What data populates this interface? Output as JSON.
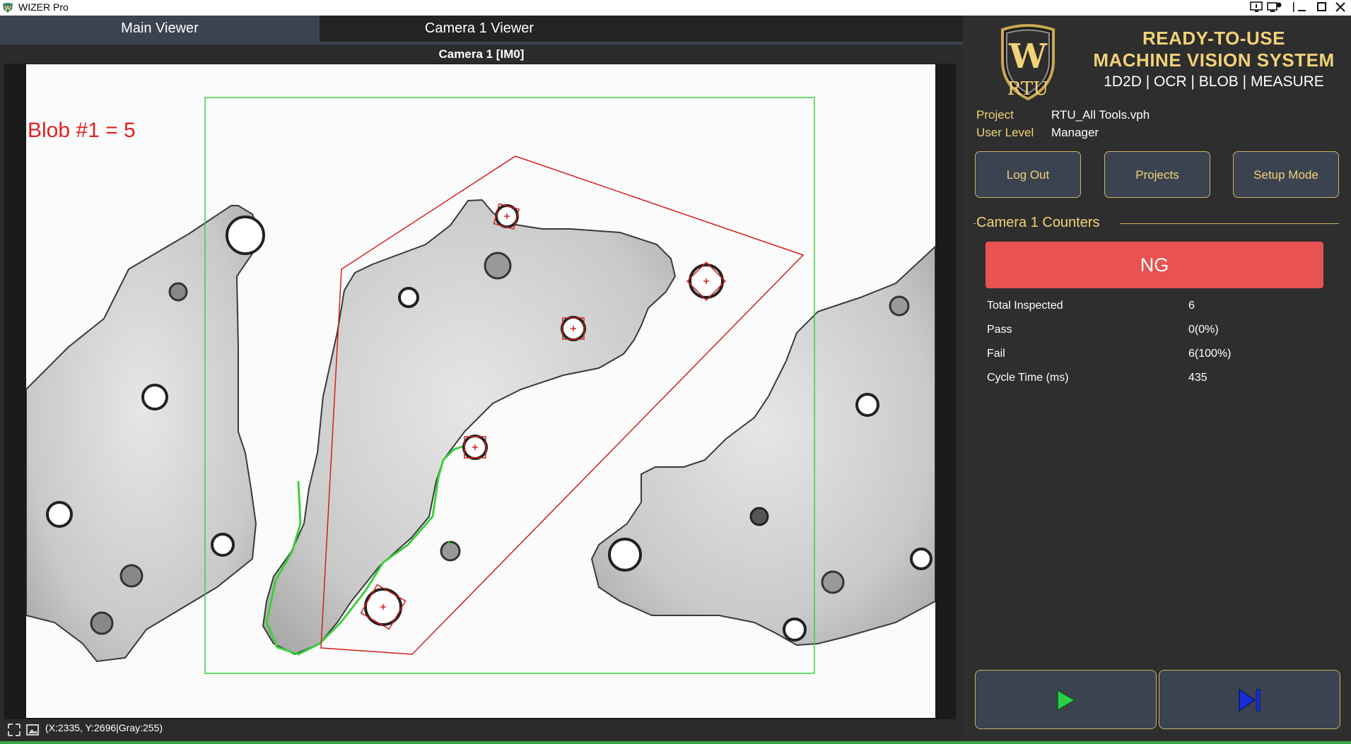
{
  "window": {
    "title": "WIZER Pro"
  },
  "tabs": [
    {
      "label": "Main Viewer",
      "active": true
    },
    {
      "label": "Camera 1 Viewer",
      "active": false
    }
  ],
  "viewer": {
    "title": "Camera 1  [IM0]",
    "overlay_label": "Blob #1 = 5"
  },
  "status": {
    "coords": "(X:2335, Y:2696|Gray:255)"
  },
  "brand": {
    "line1": "READY-TO-USE",
    "line2": "MACHINE VISION SYSTEM",
    "features": "1D2D | OCR | BLOB | MEASURE",
    "logo_text": "RTU",
    "logo_letter": "W"
  },
  "info": {
    "project_label": "Project",
    "project_value": "RTU_All Tools.vph",
    "user_level_label": "User Level",
    "user_level_value": "Manager"
  },
  "buttons": {
    "log_out": "Log Out",
    "projects": "Projects",
    "setup_mode": "Setup Mode"
  },
  "counters": {
    "title": "Camera 1 Counters",
    "result": "NG",
    "rows": [
      {
        "label": "Total Inspected",
        "value": "6"
      },
      {
        "label": "Pass",
        "value": "0(0%)"
      },
      {
        "label": "Fail",
        "value": "6(100%)"
      },
      {
        "label": "Cycle Time (ms)",
        "value": "435"
      }
    ]
  },
  "colors": {
    "accent_gold": "#f2d278",
    "ng_red": "#e95252",
    "panel_bg": "#2e2e2e",
    "button_bg": "#3b4350",
    "play_green": "#2bcf4a",
    "step_blue": "#1530d8"
  }
}
